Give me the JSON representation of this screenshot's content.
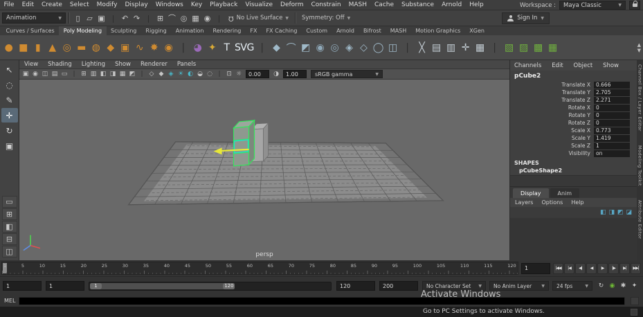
{
  "palette": {
    "shelf_orange": "#cf8b31",
    "selection_green": "#35e65c",
    "face_highlight_teal": "#25dfc3",
    "arrow_yellow": "#e8e838",
    "layer_icon_blue": "#58a6c4"
  },
  "menubar": {
    "items": [
      "File",
      "Edit",
      "Create",
      "Select",
      "Modify",
      "Display",
      "Windows",
      "Key",
      "Playback",
      "Visualize",
      "Deform",
      "Constrain",
      "MASH",
      "Cache",
      "Substance",
      "Arnold",
      "Help"
    ],
    "workspace_label": "Workspace :",
    "workspace_value": "Maya Classic"
  },
  "toolbar": {
    "menuset": "Animation",
    "icons": [
      {
        "n": "new-scene-icon",
        "g": "▯"
      },
      {
        "n": "open-scene-icon",
        "g": "▱"
      },
      {
        "n": "save-scene-icon",
        "g": "▣"
      },
      {
        "n": "separator",
        "g": "|",
        "c": "#2d2d2d"
      },
      {
        "n": "undo-icon",
        "g": "↶"
      },
      {
        "n": "redo-icon",
        "g": "↷"
      },
      {
        "n": "separator",
        "g": "|",
        "c": "#2d2d2d"
      },
      {
        "n": "snap-to-grid-icon",
        "g": "⊞"
      },
      {
        "n": "snap-to-curve-icon",
        "g": "⌒"
      },
      {
        "n": "snap-to-point-icon",
        "g": "◎"
      },
      {
        "n": "snap-to-plane-icon",
        "g": "▦"
      },
      {
        "n": "make-live-icon",
        "g": "◉"
      },
      {
        "n": "separator",
        "g": "|",
        "c": "#2d2d2d"
      }
    ],
    "no_live_surface": "No Live Surface",
    "symmetry": "Symmetry: Off",
    "sign_in": "Sign In"
  },
  "shelf": {
    "tabs": [
      {
        "label": "Curves / Surfaces"
      },
      {
        "label": "Poly Modeling",
        "bg": "#4a4a4a",
        "fg": "#ffffff"
      },
      {
        "label": "Sculpting"
      },
      {
        "label": "Rigging"
      },
      {
        "label": "Animation"
      },
      {
        "label": "Rendering"
      },
      {
        "label": "FX"
      },
      {
        "label": "FX Caching"
      },
      {
        "label": "Custom"
      },
      {
        "label": "Arnold"
      },
      {
        "label": "Bifrost"
      },
      {
        "label": "MASH"
      },
      {
        "label": "Motion Graphics"
      },
      {
        "label": "XGen"
      }
    ],
    "icons": [
      {
        "n": "poly-sphere-icon",
        "g": "●",
        "c": "#cf8b31"
      },
      {
        "n": "poly-cube-icon",
        "g": "■",
        "c": "#cf8b31"
      },
      {
        "n": "poly-cylinder-icon",
        "g": "▮",
        "c": "#cf8b31"
      },
      {
        "n": "poly-cone-icon",
        "g": "▲",
        "c": "#cf8b31"
      },
      {
        "n": "poly-torus-icon",
        "g": "◎",
        "c": "#cf8b31"
      },
      {
        "n": "poly-plane-icon",
        "g": "▬",
        "c": "#cf8b31"
      },
      {
        "n": "poly-disc-icon",
        "g": "◍",
        "c": "#cf8b31"
      },
      {
        "n": "poly-platonic-icon",
        "g": "◆",
        "c": "#cf8b31"
      },
      {
        "n": "poly-pipe-icon",
        "g": "▣",
        "c": "#cf8b31"
      },
      {
        "n": "poly-helix-icon",
        "g": "∿",
        "c": "#cf8b31"
      },
      {
        "n": "poly-gear-icon",
        "g": "✸",
        "c": "#cf8b31"
      },
      {
        "n": "poly-soccer-ball-icon",
        "g": "◉",
        "c": "#cf8b31"
      },
      {
        "n": "separator",
        "g": "|",
        "c": "#2e2e2e"
      },
      {
        "n": "sculpt-tool-icon",
        "g": "◕",
        "c": "#9a6ab8"
      },
      {
        "n": "super-ellipse-icon",
        "g": "✦",
        "c": "#d8a936"
      },
      {
        "n": "type-tool-icon",
        "g": "T",
        "c": "#e8f0f6"
      },
      {
        "n": "svg-tool-icon",
        "g": "SVG",
        "c": "#e8f0f6"
      },
      {
        "n": "separator",
        "g": "|",
        "c": "#2e2e2e"
      },
      {
        "n": "bevel-icon",
        "g": "◆",
        "c": "#9fb9c8"
      },
      {
        "n": "bridge-icon",
        "g": "⌒",
        "c": "#9fb9c8"
      },
      {
        "n": "extrude-icon",
        "g": "◩",
        "c": "#9fb9c8"
      },
      {
        "n": "boolean-union-icon",
        "g": "◉",
        "c": "#8fa8b8"
      },
      {
        "n": "boolean-difference-icon",
        "g": "◎",
        "c": "#8fa8b8"
      },
      {
        "n": "combine-icon",
        "g": "◈",
        "c": "#9fb9c8"
      },
      {
        "n": "separate-icon",
        "g": "◇",
        "c": "#9fb9c8"
      },
      {
        "n": "smooth-icon",
        "g": "◯",
        "c": "#9fb9c8"
      },
      {
        "n": "mirror-icon",
        "g": "◫",
        "c": "#9fb9c8"
      },
      {
        "n": "separator",
        "g": "|",
        "c": "#2e2e2e"
      },
      {
        "n": "multi-cut-icon",
        "g": "╳",
        "c": "#c3cdd4"
      },
      {
        "n": "insert-edge-loop-icon",
        "g": "▤",
        "c": "#c3cdd4"
      },
      {
        "n": "offset-edge-loop-icon",
        "g": "▥",
        "c": "#c3cdd4"
      },
      {
        "n": "target-weld-icon",
        "g": "✛",
        "c": "#c3cdd4"
      },
      {
        "n": "quad-draw-icon",
        "g": "▦",
        "c": "#c3cdd4"
      },
      {
        "n": "separator",
        "g": "|",
        "c": "#2e2e2e"
      },
      {
        "n": "green-modeling-icon-1",
        "g": "▧",
        "c": "#6fae3f"
      },
      {
        "n": "green-modeling-icon-2",
        "g": "▨",
        "c": "#6fae3f"
      },
      {
        "n": "green-modeling-icon-3",
        "g": "▩",
        "c": "#6fae3f"
      },
      {
        "n": "green-modeling-icon-4",
        "g": "▦",
        "c": "#6fae3f"
      }
    ],
    "scroll_up": "▲",
    "scroll_down": "▼"
  },
  "tools": {
    "items": [
      {
        "n": "select-tool",
        "g": "↖"
      },
      {
        "n": "lasso-tool",
        "g": "◌"
      },
      {
        "n": "paint-select-tool",
        "g": "✎"
      },
      {
        "n": "move-tool",
        "g": "✛",
        "bg": "#5a6a78",
        "c": "#ffffff"
      },
      {
        "n": "rotate-tool",
        "g": "↻"
      },
      {
        "n": "scale-tool",
        "g": "▣"
      }
    ],
    "layouts": [
      {
        "n": "layout-single-pane",
        "g": "▭"
      },
      {
        "n": "layout-four-pane",
        "g": "⊞"
      },
      {
        "n": "layout-persp-outliner",
        "g": "◧"
      },
      {
        "n": "layout-persp-graph",
        "g": "⊟"
      },
      {
        "n": "layout-hypershade",
        "g": "◫"
      }
    ]
  },
  "viewport": {
    "menus": [
      "View",
      "Shading",
      "Lighting",
      "Show",
      "Renderer",
      "Panels"
    ],
    "toolbar_icons": [
      {
        "n": "select-camera-icon",
        "g": "▣"
      },
      {
        "n": "lock-camera-icon",
        "g": "◉"
      },
      {
        "n": "camera-attributes-icon",
        "g": "◫"
      },
      {
        "n": "bookmarks-icon",
        "g": "▤"
      },
      {
        "n": "image-plane-icon",
        "g": "▭"
      },
      {
        "n": "separator",
        "g": "|",
        "c": "#2d2d2d"
      },
      {
        "n": "grid-toggle-icon",
        "g": "⊞"
      },
      {
        "n": "film-gate-icon",
        "g": "▥"
      },
      {
        "n": "resolution-gate-icon",
        "g": "◧"
      },
      {
        "n": "gate-mask-icon",
        "g": "◨"
      },
      {
        "n": "field-chart-icon",
        "g": "▦"
      },
      {
        "n": "safe-action-icon",
        "g": "◩"
      },
      {
        "n": "separator",
        "g": "|",
        "c": "#2d2d2d"
      },
      {
        "n": "wireframe-icon",
        "g": "◇"
      },
      {
        "n": "shaded-icon",
        "g": "◆"
      },
      {
        "n": "textured-icon",
        "g": "◈",
        "c": "#49b8c9"
      },
      {
        "n": "use-all-lights-icon",
        "g": "☀",
        "c": "#49b8c9"
      },
      {
        "n": "shadows-icon",
        "g": "◐",
        "c": "#49b8c9"
      },
      {
        "n": "ssao-icon",
        "g": "◒"
      },
      {
        "n": "motion-blur-icon",
        "g": "◌"
      },
      {
        "n": "separator",
        "g": "|",
        "c": "#2d2d2d"
      },
      {
        "n": "isolate-select-icon",
        "g": "⊡"
      }
    ],
    "exposure_icon": "☼",
    "exposure": "0.00",
    "gamma_icon": "◑",
    "gamma": "1.00",
    "view_transform": "sRGB gamma",
    "camera_label": "persp"
  },
  "channel_box": {
    "menus": [
      "Channels",
      "Edit",
      "Object",
      "Show"
    ],
    "node": "pCube2",
    "attributes": [
      {
        "label": "Translate X",
        "value": "0.666"
      },
      {
        "label": "Translate Y",
        "value": "2.705"
      },
      {
        "label": "Translate Z",
        "value": "2.271"
      },
      {
        "label": "Rotate X",
        "value": "0"
      },
      {
        "label": "Rotate Y",
        "value": "0"
      },
      {
        "label": "Rotate Z",
        "value": "0"
      },
      {
        "label": "Scale X",
        "value": "0.773"
      },
      {
        "label": "Scale Y",
        "value": "1.419"
      },
      {
        "label": "Scale Z",
        "value": "1"
      },
      {
        "label": "Visibility",
        "value": "on"
      }
    ],
    "shapes_header": "SHAPES",
    "shape_node": "pCubeShape2"
  },
  "layer_editor": {
    "tabs": [
      {
        "label": "Display",
        "bg": "#4c4c4c",
        "fg": "#ffffff"
      },
      {
        "label": "Anim"
      }
    ],
    "menus": [
      "Layers",
      "Options",
      "Help"
    ],
    "icons": [
      {
        "n": "layer-sort-icon",
        "g": "◧"
      },
      {
        "n": "new-empty-layer-icon",
        "g": "◨"
      },
      {
        "n": "new-layer-from-selected-icon",
        "g": "◩"
      },
      {
        "n": "layer-options-icon",
        "g": "◪"
      }
    ]
  },
  "side_tabs": [
    "Channel Box / Layer Editor",
    "Modeling Toolkit",
    "Attribute Editor"
  ],
  "timeline": {
    "ticks": [
      "1",
      "5",
      "10",
      "15",
      "20",
      "25",
      "30",
      "35",
      "40",
      "45",
      "50",
      "55",
      "60",
      "65",
      "70",
      "75",
      "80",
      "85",
      "90",
      "95",
      "100",
      "105",
      "110",
      "115",
      "120"
    ],
    "current_frame": "1",
    "playback": [
      {
        "n": "go-to-start-button",
        "g": "|◀◀"
      },
      {
        "n": "step-back-frame-button",
        "g": "|◀"
      },
      {
        "n": "step-back-key-button",
        "g": "◀|"
      },
      {
        "n": "play-backwards-button",
        "g": "◀"
      },
      {
        "n": "play-forwards-button",
        "g": "▶"
      },
      {
        "n": "step-forward-key-button",
        "g": "|▶"
      },
      {
        "n": "step-forward-frame-button",
        "g": "▶|"
      },
      {
        "n": "go-to-end-button",
        "g": "▶▶|"
      }
    ]
  },
  "range": {
    "anim_start": "1",
    "play_start": "1",
    "slider_start": "1",
    "slider_end": "120",
    "play_end": "120",
    "anim_end": "200",
    "character_set": "No Character Set",
    "anim_layer": "No Anim Layer",
    "fps": "24 fps",
    "icons": [
      {
        "n": "playback-loop-icon",
        "g": "↻",
        "c": "#c8c8c8"
      },
      {
        "n": "auto-keyframe-icon",
        "g": "◉",
        "c": "#6fba35"
      },
      {
        "n": "animation-preferences-icon",
        "g": "✱",
        "c": "#c8c8c8"
      },
      {
        "n": "time-settings-icon",
        "g": "✦",
        "c": "#c8c8c8"
      }
    ]
  },
  "command_line": {
    "label": "MEL"
  },
  "watermark": {
    "line1": "Activate Windows",
    "line2": "Go to PC Settings to activate Windows."
  }
}
